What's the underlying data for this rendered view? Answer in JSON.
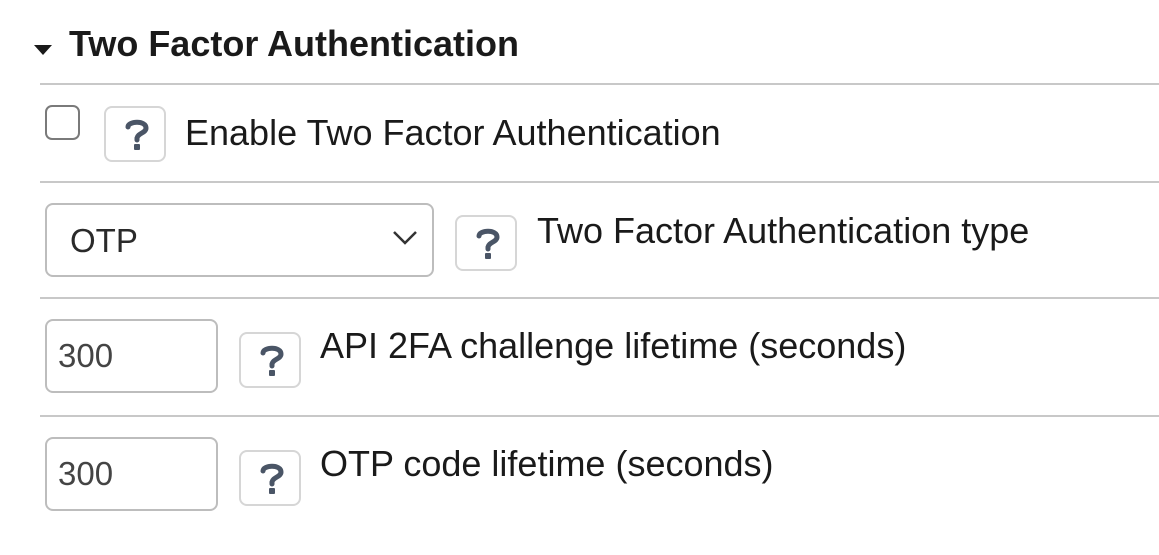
{
  "section": {
    "title": "Two Factor Authentication",
    "expanded": true,
    "caret_icon": "caret-down-icon"
  },
  "rows": [
    {
      "control": "checkbox",
      "checked": false,
      "help_icon": "question-mark-icon",
      "label": "Enable Two Factor Authentication"
    },
    {
      "control": "select",
      "value": "OTP",
      "chevron_icon": "chevron-down-icon",
      "help_icon": "question-mark-icon",
      "label": "Two Factor Authentication type"
    },
    {
      "control": "number",
      "value": "300",
      "help_icon": "question-mark-icon",
      "label": "API 2FA challenge lifetime (seconds)"
    },
    {
      "control": "number",
      "value": "300",
      "help_icon": "question-mark-icon",
      "label": "OTP code lifetime (seconds)"
    }
  ],
  "colors": {
    "text": "#1a1a1a",
    "help_icon": "#4a5566",
    "divider": "#c8c8c8",
    "border": "#bdbdbd"
  }
}
